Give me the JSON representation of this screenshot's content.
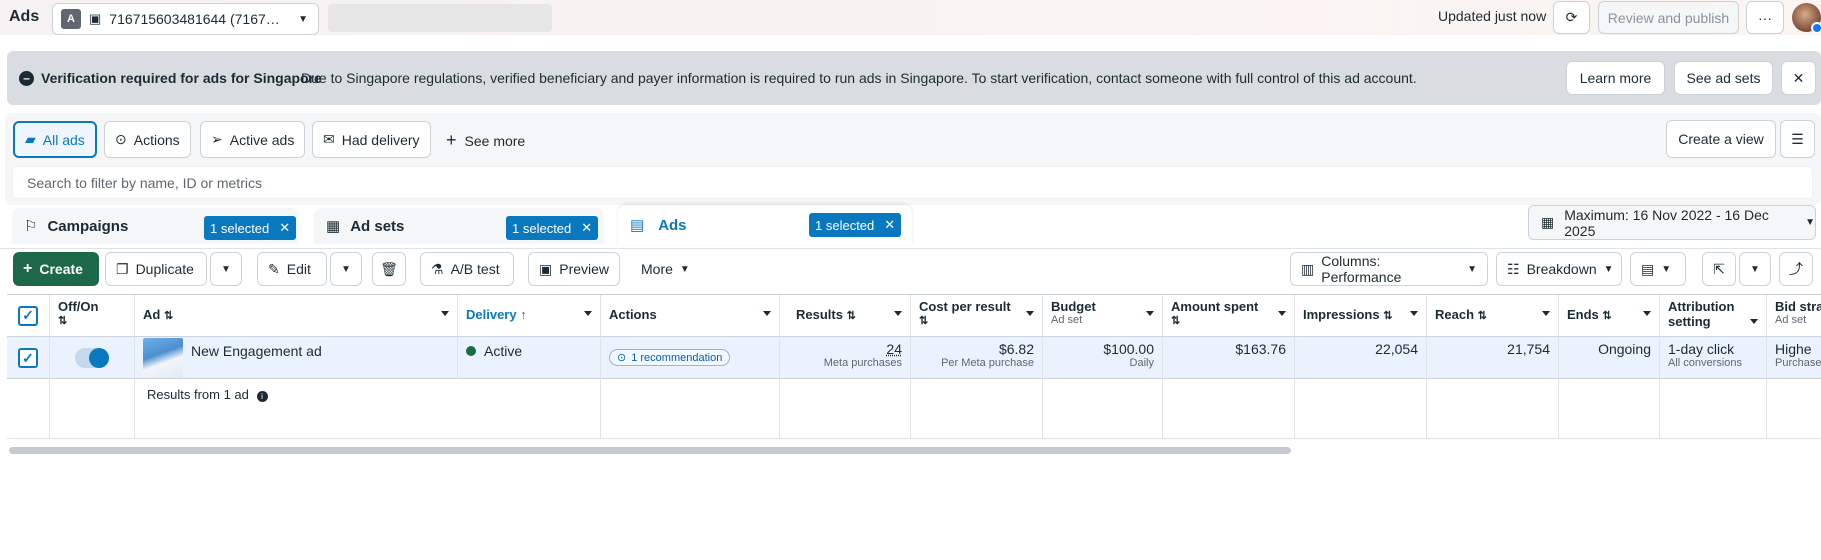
{
  "header": {
    "app_title": "Ads",
    "account_badge": "A",
    "account_id": "716715603481644 (7167…",
    "updated_text": "Updated just now",
    "review_publish_label": "Review and publish",
    "more_label": "···"
  },
  "banner": {
    "title": "Verification required for ads for Singapore",
    "message": "Due to Singapore regulations, verified beneficiary and payer information is required to run ads in Singapore. To start verification, contact someone with full control of this ad account.",
    "learn_more": "Learn more",
    "see_ad_sets": "See ad sets",
    "close_glyph": "✕"
  },
  "filters": {
    "chips": [
      "All ads",
      "Actions",
      "Active ads",
      "Had delivery"
    ],
    "see_more": "See more",
    "create_view": "Create a view",
    "search_placeholder": "Search to filter by name, ID or metrics"
  },
  "tabs": {
    "campaigns": "Campaigns",
    "ad_sets": "Ad sets",
    "ads": "Ads",
    "selected_label": "1 selected"
  },
  "date_range": "Maximum: 16 Nov 2022 - 16 Dec 2025",
  "toolbar": {
    "create": "Create",
    "duplicate": "Duplicate",
    "edit": "Edit",
    "ab_test": "A/B test",
    "preview": "Preview",
    "more": "More",
    "columns": "Columns: Performance",
    "breakdown": "Breakdown"
  },
  "table": {
    "headers": {
      "off_on": "Off/On",
      "ad": "Ad",
      "delivery": "Delivery",
      "actions": "Actions",
      "results": "Results",
      "cost_per_result": "Cost per result",
      "budget": "Budget",
      "budget_sub": "Ad set",
      "amount_spent": "Amount spent",
      "impressions": "Impressions",
      "reach": "Reach",
      "ends": "Ends",
      "attribution": "Attribution setting",
      "bid_strategy": "Bid stra",
      "bid_sub": "Ad set"
    },
    "row": {
      "ad_name": "New Engagement ad",
      "delivery": "Active",
      "recommendation": "1 recommendation",
      "results": "24",
      "results_sub": "Meta purchases",
      "cost_per_result": "$6.82",
      "cost_sub": "Per Meta purchase",
      "budget": "$100.00",
      "budget_sub": "Daily",
      "amount_spent": "$163.76",
      "impressions": "22,054",
      "reach": "21,754",
      "ends": "Ongoing",
      "attribution": "1-day click",
      "attribution_sub": "All conversions",
      "bid": "Highe",
      "bid_sub": "Purchase"
    },
    "results_from": "Results from 1 ad"
  },
  "colors": {
    "accent": "#0a78be",
    "create_green": "#1d6848",
    "active_dot": "#1d6848",
    "banner_bg": "#d9dde1"
  }
}
